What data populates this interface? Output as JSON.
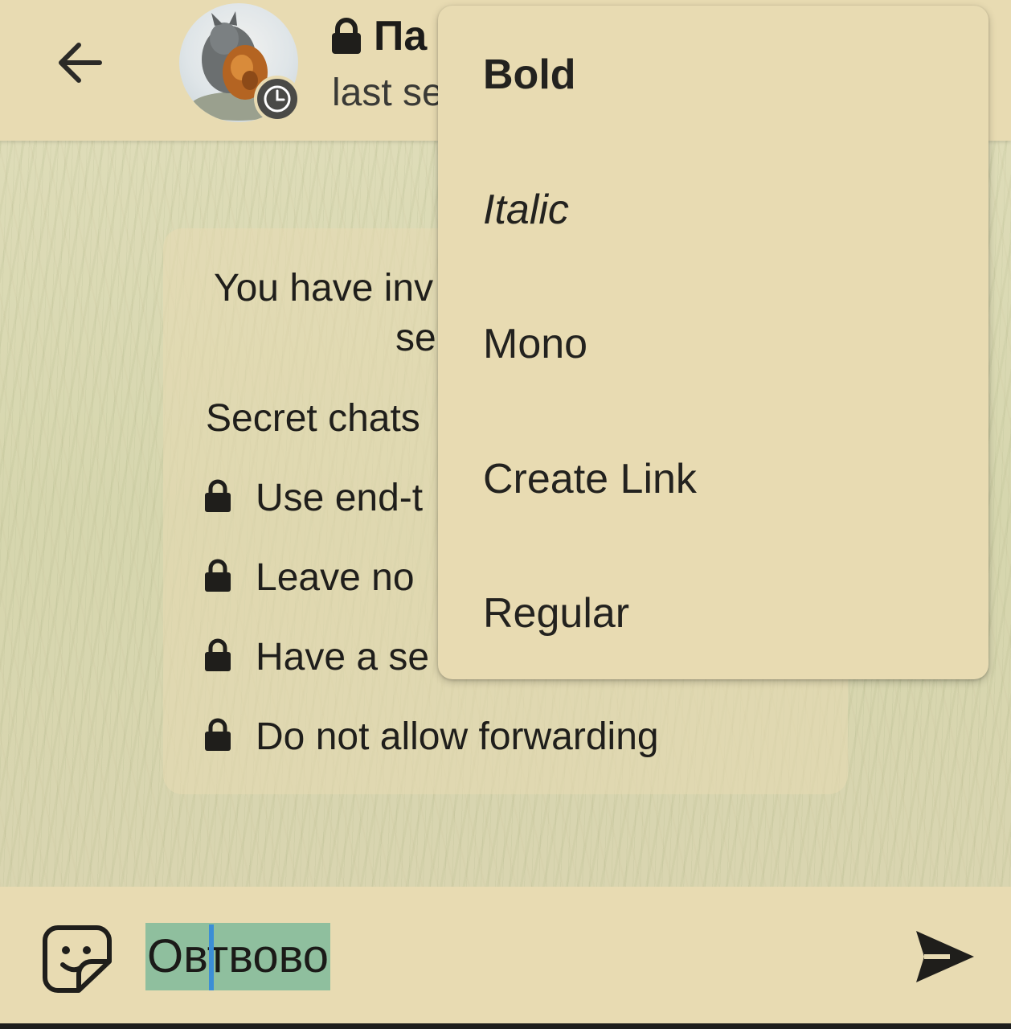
{
  "header": {
    "chat_title": "Па",
    "status": "last se"
  },
  "bubble": {
    "line1": "You have inv",
    "line2": "se",
    "line3": "Secret chats",
    "features": [
      "Use end-t",
      "Leave no",
      "Have a se",
      "Do not allow forwarding"
    ]
  },
  "menu": {
    "items": [
      {
        "label": "Bold"
      },
      {
        "label": "Italic"
      },
      {
        "label": "Mono"
      },
      {
        "label": "Create Link"
      },
      {
        "label": "Regular"
      }
    ]
  },
  "composer": {
    "text": "Овтвово"
  },
  "colors": {
    "header_bg": "#e8dbb2",
    "selection": "#8fbf9e",
    "cursor": "#3b8ed6"
  },
  "icons": [
    "back-arrow-icon",
    "lock-icon",
    "timer-icon",
    "sticker-icon",
    "send-icon"
  ]
}
